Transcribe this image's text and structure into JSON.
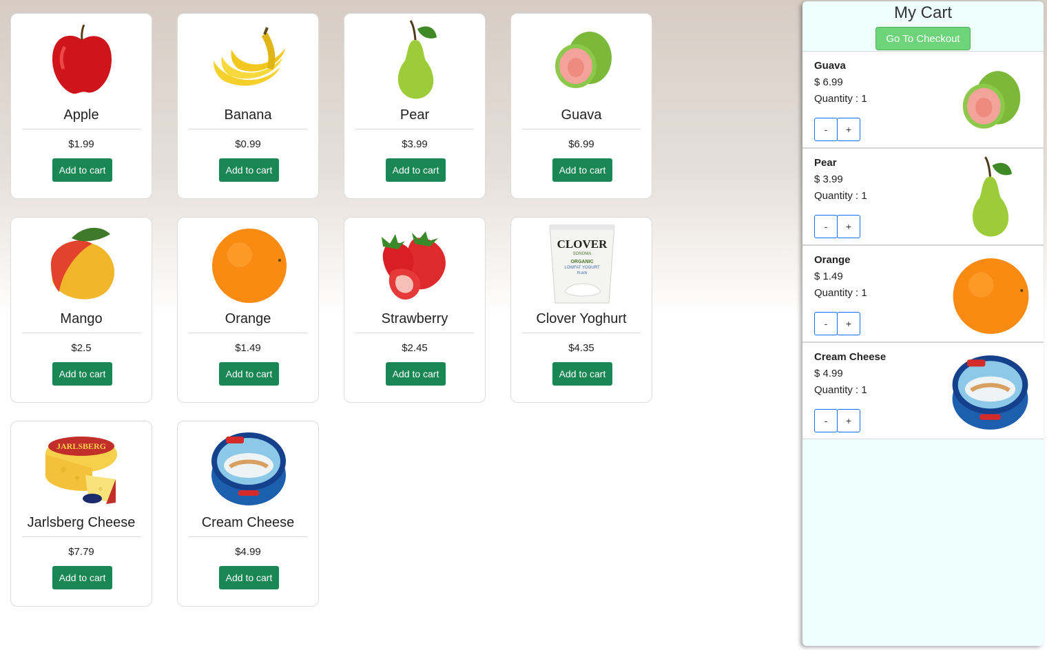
{
  "products": [
    {
      "name": "Apple",
      "price": "$1.99",
      "button": "Add to cart",
      "icon": "apple-image"
    },
    {
      "name": "Banana",
      "price": "$0.99",
      "button": "Add to cart",
      "icon": "banana-image"
    },
    {
      "name": "Pear",
      "price": "$3.99",
      "button": "Add to cart",
      "icon": "pear-image"
    },
    {
      "name": "Guava",
      "price": "$6.99",
      "button": "Add to cart",
      "icon": "guava-image"
    },
    {
      "name": "Mango",
      "price": "$2.5",
      "button": "Add to cart",
      "icon": "mango-image"
    },
    {
      "name": "Orange",
      "price": "$1.49",
      "button": "Add to cart",
      "icon": "orange-image"
    },
    {
      "name": "Strawberry",
      "price": "$2.45",
      "button": "Add to cart",
      "icon": "strawberry-image"
    },
    {
      "name": "Clover Yoghurt",
      "price": "$4.35",
      "button": "Add to cart",
      "icon": "yoghurt-image"
    },
    {
      "name": "Jarlsberg Cheese",
      "price": "$7.79",
      "button": "Add to cart",
      "icon": "cheese-image"
    },
    {
      "name": "Cream Cheese",
      "price": "$4.99",
      "button": "Add to cart",
      "icon": "cream-cheese-image"
    }
  ],
  "cart": {
    "title": "My Cart",
    "checkout_label": "Go To Checkout",
    "items": [
      {
        "name": "Guava",
        "price": "$ 6.99",
        "quantity": "Quantity : 1",
        "minus": "-",
        "plus": "+",
        "icon": "guava-image"
      },
      {
        "name": "Pear",
        "price": "$ 3.99",
        "quantity": "Quantity : 1",
        "minus": "-",
        "plus": "+",
        "icon": "pear-image"
      },
      {
        "name": "Orange",
        "price": "$ 1.49",
        "quantity": "Quantity : 1",
        "minus": "-",
        "plus": "+",
        "icon": "orange-image"
      },
      {
        "name": "Cream Cheese",
        "price": "$ 4.99",
        "quantity": "Quantity : 1",
        "minus": "-",
        "plus": "+",
        "icon": "cream-cheese-image"
      }
    ]
  },
  "colors": {
    "add_button": "#198754",
    "checkout_button": "#6ed47a",
    "cart_background": "#eefffe",
    "quantity_button_border": "#0d6efd"
  },
  "label_art": {
    "yoghurt_brand": "CLOVER",
    "yoghurt_sub": "SONOMA",
    "yoghurt_line1": "ORGANIC",
    "yoghurt_line2": "LOWFAT YOGURT",
    "yoghurt_line3": "PLAIN",
    "cheese_brand": "JARLSBERG"
  }
}
